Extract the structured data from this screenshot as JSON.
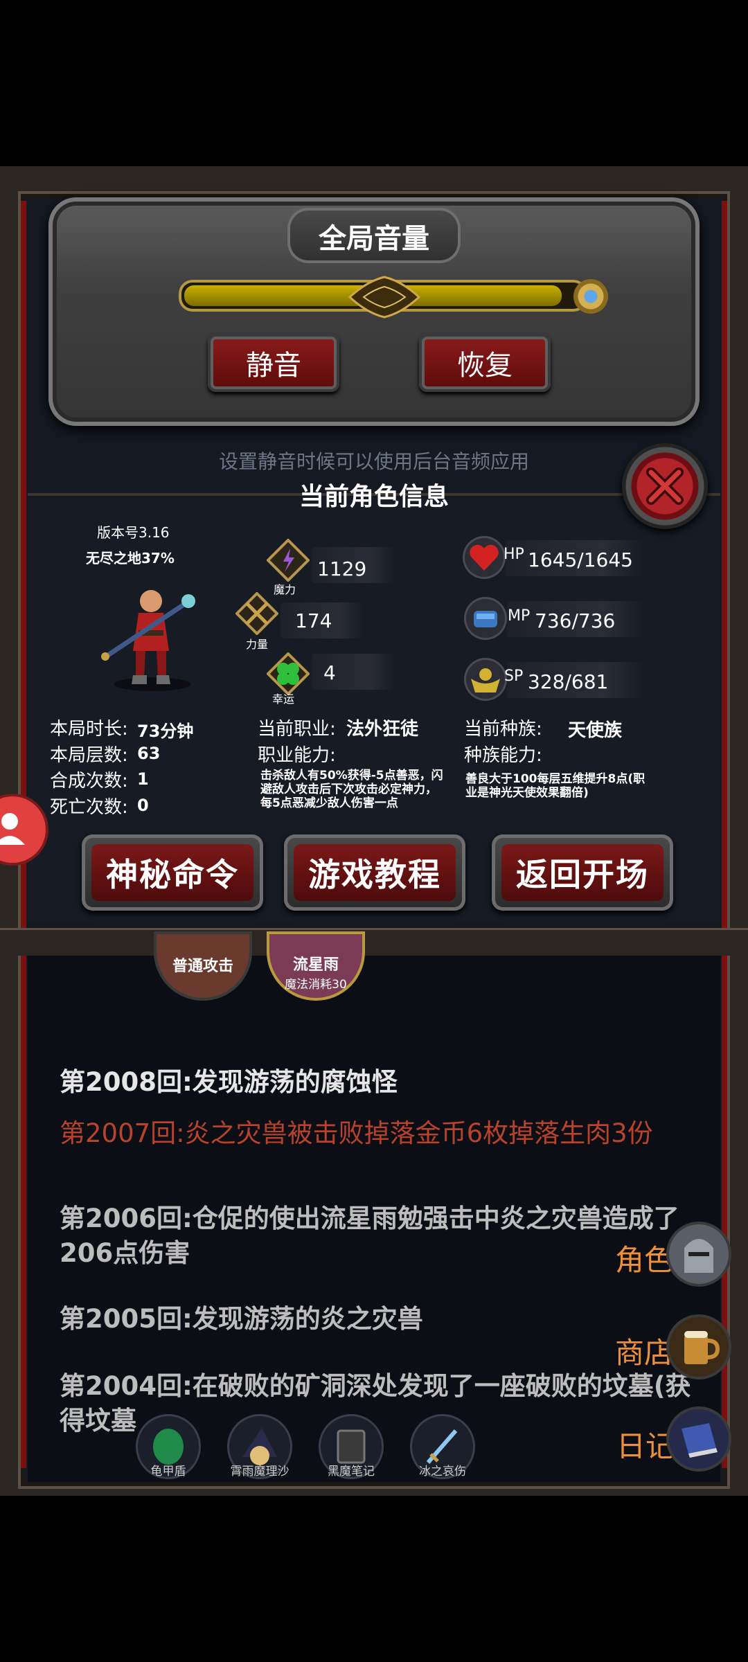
{
  "volume": {
    "title": "全局音量",
    "level": 0.95,
    "mute_label": "静音",
    "restore_label": "恢复",
    "hint": "设置静音时候可以使用后台音频应用"
  },
  "character": {
    "title": "当前角色信息",
    "version": "版本号3.16",
    "realm": "无尽之地37%",
    "stats": {
      "magic": {
        "value": "1129",
        "label": "魔力"
      },
      "strength": {
        "value": "174",
        "label": "力量"
      },
      "luck": {
        "value": "4",
        "label": "幸运"
      }
    },
    "vitals": {
      "hp_tag": "HP",
      "hp": "1645/1645",
      "mp_tag": "MP",
      "mp": "736/736",
      "sp_tag": "SP",
      "sp": "328/681"
    },
    "run_info": {
      "duration_label": "本局时长:",
      "duration": "73分钟",
      "floor_label": "本局层数:",
      "floor": "63",
      "merge_label": "合成次数:",
      "merge": "1",
      "death_label": "死亡次数:",
      "death": "0"
    },
    "job_label": "当前职业:",
    "job": "法外狂徒",
    "job_ability_label": "职业能力:",
    "job_ability": "击杀敌人有50%获得-5点善恶，闪避敌人攻击后下次攻击必定神力，每5点恶减少敌人伤害一点",
    "race_label": "当前种族:",
    "race": "天使族",
    "race_ability_label": "种族能力:",
    "race_ability": "善良大于100每层五维提升8点(职业是神光天使效果翻倍)",
    "buttons": {
      "secret": "神秘命令",
      "tutorial": "游戏教程",
      "back": "返回开场"
    }
  },
  "skills": [
    {
      "name": "普通攻击",
      "sub": ""
    },
    {
      "name": "流星雨",
      "sub": "魔法消耗30"
    }
  ],
  "log": [
    {
      "text": "第2008回:发现游荡的腐蚀怪",
      "color": "#e6e6e6"
    },
    {
      "text": "第2007回:炎之灾兽被击败掉落金币6枚掉落生肉3份",
      "color": "#b8432a"
    },
    {
      "text": "第2006回:仓促的使出流星雨勉强击中炎之灾兽造成了206点伤害",
      "color": "#bdbdbd"
    },
    {
      "text": "第2005回:发现游荡的炎之灾兽",
      "color": "#bdbdbd"
    },
    {
      "text": "第2004回:在破败的矿洞深处发现了一座破败的坟墓(获得坟墓",
      "color": "#bdbdbd"
    }
  ],
  "side_menu": {
    "role": "角色",
    "shop": "商店",
    "diary": "日记"
  },
  "items": [
    "龟甲盾",
    "霄雨魔理沙",
    "黑魔笔记",
    "冰之哀伤"
  ]
}
